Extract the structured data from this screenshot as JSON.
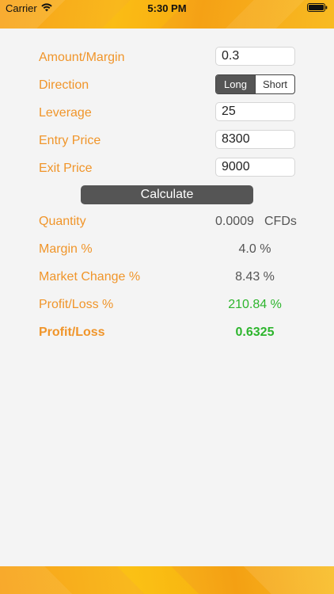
{
  "status": {
    "carrier": "Carrier",
    "time": "5:30 PM"
  },
  "form": {
    "amount_label": "Amount/Margin",
    "amount_value": "0.3",
    "direction_label": "Direction",
    "direction_options": [
      "Long",
      "Short"
    ],
    "direction_selected": "Long",
    "leverage_label": "Leverage",
    "leverage_value": "25",
    "entry_label": "Entry Price",
    "entry_value": "8300",
    "exit_label": "Exit Price",
    "exit_value": "9000"
  },
  "calculate_label": "Calculate",
  "results": {
    "quantity_label": "Quantity",
    "quantity_value": "0.0009",
    "quantity_unit": "CFDs",
    "margin_label": "Margin %",
    "margin_value": "4.0 %",
    "market_change_label": "Market Change %",
    "market_change_value": "8.43 %",
    "pl_pct_label": "Profit/Loss %",
    "pl_pct_value": "210.84 %",
    "pl_label": "Profit/Loss",
    "pl_value": "0.6325"
  },
  "colors": {
    "accent_orange": "#f0952a",
    "positive_green": "#2db52d",
    "button_gray": "#555555"
  }
}
